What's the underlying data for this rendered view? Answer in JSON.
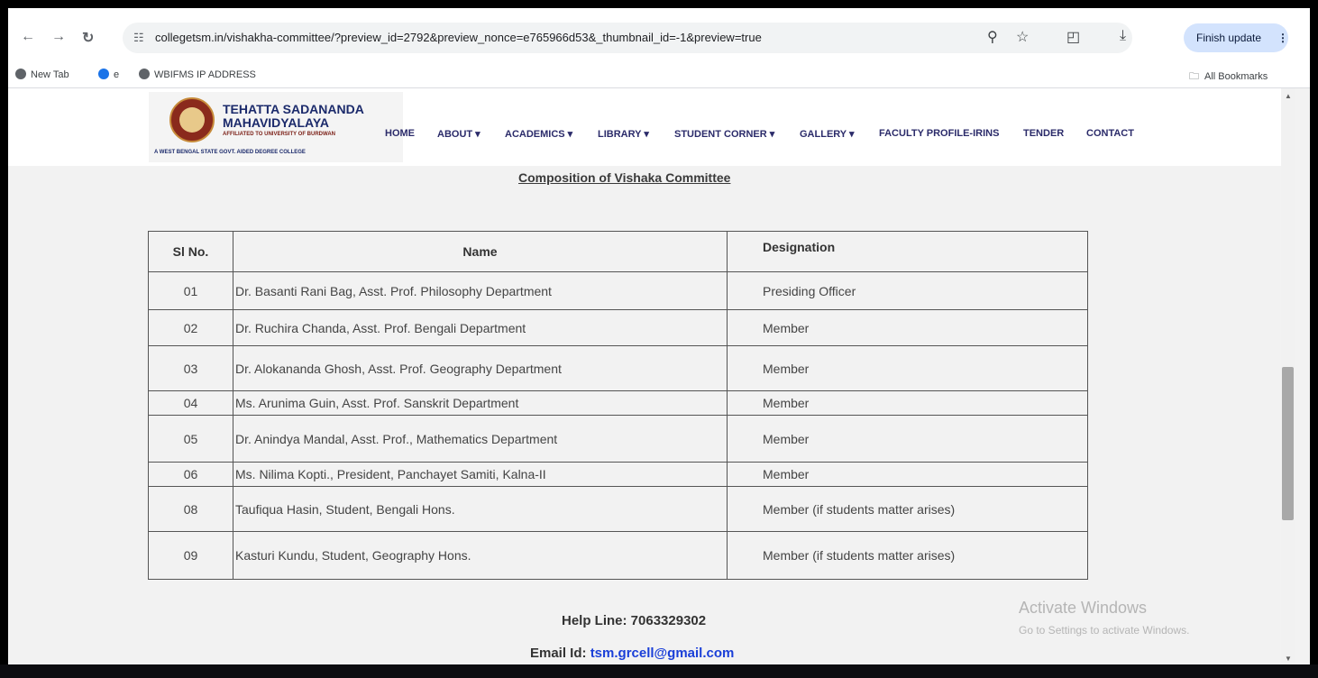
{
  "browser": {
    "url": "collegetsm.in/vishakha-committee/?preview_id=2792&preview_nonce=e765966d53&_thumbnail_id=-1&preview=true",
    "finish_update": "Finish update",
    "bookmarks": [
      "New Tab",
      "e",
      "WBIFMS IP ADDRESS"
    ],
    "all_bookmarks": "All Bookmarks"
  },
  "college": {
    "name_line1": "TEHATTA SADANANDA",
    "name_line2": "MAHAVIDYALAYA",
    "affiliation": "AFFILIATED TO UNIVERSITY OF BURDWAN",
    "tagline": "A WEST BENGAL STATE GOVT. AIDED DEGREE COLLEGE"
  },
  "nav": [
    "HOME",
    "ABOUT ▾",
    "ACADEMICS ▾",
    "LIBRARY ▾",
    "STUDENT CORNER ▾",
    "GALLERY ▾",
    "FACULTY PROFILE-IRINS",
    "TENDER",
    "CONTACT"
  ],
  "page_title": "Composition of Vishaka Committee",
  "table": {
    "headers": [
      "Sl No.",
      "Name",
      "Designation"
    ],
    "rows": [
      [
        "01",
        "Dr. Basanti Rani Bag, Asst. Prof. Philosophy Department",
        "Presiding Officer"
      ],
      [
        "02",
        "Dr. Ruchira Chanda, Asst. Prof. Bengali Department",
        "Member"
      ],
      [
        "03",
        "Dr. Alokananda Ghosh, Asst. Prof. Geography Department",
        "Member"
      ],
      [
        "04",
        "Ms. Arunima Guin, Asst. Prof. Sanskrit Department",
        "Member"
      ],
      [
        "05",
        "Dr. Anindya Mandal, Asst. Prof., Mathematics Department",
        "Member"
      ],
      [
        "06",
        "Ms. Nilima Kopti., President, Panchayet Samiti, Kalna-II",
        "Member"
      ],
      [
        "08",
        "Taufiqua Hasin, Student, Bengali Hons.",
        "Member (if students matter arises)"
      ],
      [
        "09",
        "Kasturi Kundu, Student, Geography Hons.",
        "Member (if students matter arises)"
      ]
    ]
  },
  "helpline": "Help Line: 7063329302",
  "email_label": "Email Id:",
  "email": "tsm.grcell@gmail.com",
  "watermark": {
    "title": "Activate Windows",
    "subtitle": "Go to Settings to activate Windows."
  }
}
